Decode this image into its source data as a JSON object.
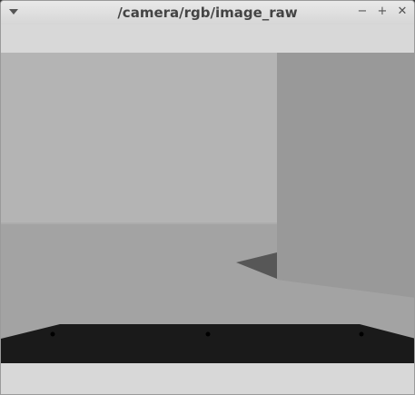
{
  "window": {
    "title": "/camera/rgb/image_raw",
    "menu_icon": "triangle-down-icon",
    "minimize_glyph": "−",
    "maximize_glyph": "+",
    "close_glyph": "✕"
  },
  "image_view": {
    "description_icon": "camera-image"
  }
}
